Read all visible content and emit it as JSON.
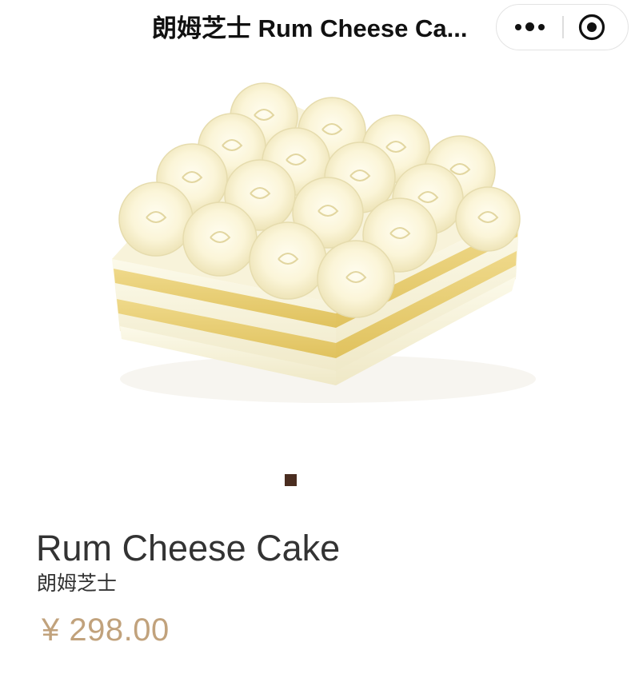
{
  "header": {
    "title": "朗姆芝士 Rum Cheese Ca..."
  },
  "capsule": {
    "more_icon": "more-dots-icon",
    "close_icon": "target-circle-icon"
  },
  "carousel": {
    "image_alt_icon": "cake-image",
    "indicator_count": 1,
    "active_index": 0,
    "indicator_color": "#4a2d20"
  },
  "product": {
    "name": "Rum Cheese Cake",
    "subname": "朗姆芝士",
    "price": "¥ 298.00",
    "price_color": "#c1a27c"
  }
}
